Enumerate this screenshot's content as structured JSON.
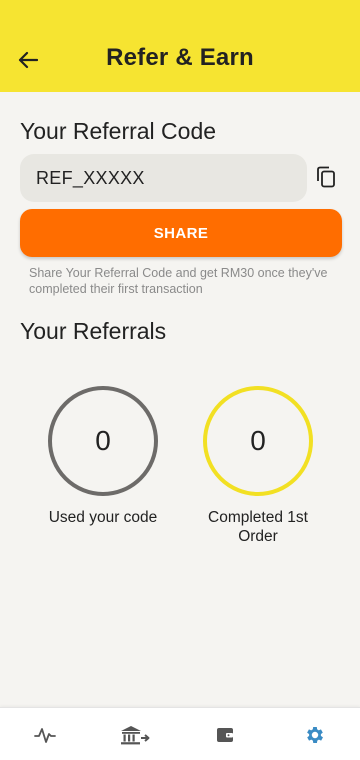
{
  "header": {
    "title": "Refer & Earn",
    "back_icon": "arrow-left-icon",
    "background_color": "#f6e431"
  },
  "referral_code": {
    "heading": "Your Referral Code",
    "value": "REF_XXXXX",
    "copy_icon": "copy-icon"
  },
  "share": {
    "button_label": "SHARE",
    "button_color": "#ff6d00",
    "hint": "Share Your Referral Code and get RM30 once they've completed their first transaction"
  },
  "referrals": {
    "heading": "Your Referrals",
    "stats": [
      {
        "count": "0",
        "label": "Used your code",
        "ring_color": "#6d6b69"
      },
      {
        "count": "0",
        "label": "Completed 1st Order",
        "ring_color": "#f2e023"
      }
    ]
  },
  "bottom_nav": {
    "items": [
      {
        "icon": "activity-icon",
        "active": false
      },
      {
        "icon": "bank-transfer-icon",
        "active": false
      },
      {
        "icon": "wallet-icon",
        "active": false
      },
      {
        "icon": "gear-icon",
        "active": true
      }
    ],
    "active_color": "#3a8bc4",
    "inactive_color": "#555555"
  }
}
